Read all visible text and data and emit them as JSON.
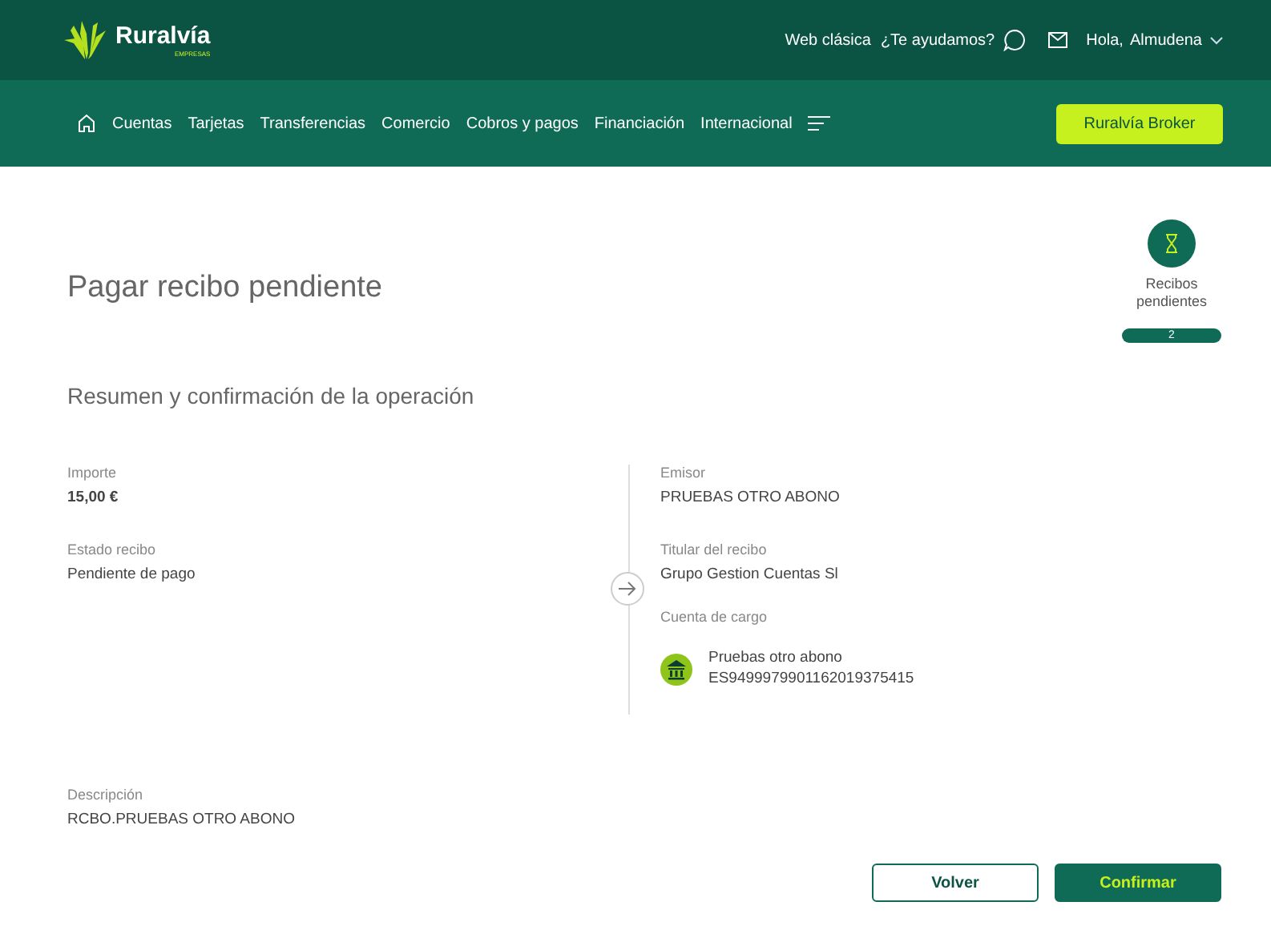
{
  "header": {
    "brand": "Ruralvía",
    "brand_sub": "EMPRESAS",
    "links": [
      "Web clásica",
      "¿Te ayudamos?"
    ],
    "greeting": "Hola,",
    "user": "Almudena"
  },
  "nav": {
    "items": [
      "Cuentas",
      "Tarjetas",
      "Transferencias",
      "Comercio",
      "Cobros y pagos",
      "Financiación",
      "Internacional"
    ],
    "action": "Ruralvía Broker"
  },
  "page": {
    "title": "Pagar recibo pendiente",
    "subtitle": "Resumen y confirmación de la operación"
  },
  "pending": {
    "label": "Recibos pendientes",
    "count": "2"
  },
  "left_fields": [
    {
      "label": "Importe",
      "value": "15,00 €",
      "bold": true
    },
    {
      "label": "Estado recibo",
      "value": "Pendiente de pago",
      "bold": false
    }
  ],
  "right_fields": [
    {
      "label": "Emisor",
      "value": "PRUEBAS OTRO ABONO"
    },
    {
      "label": "Titular del recibo",
      "value": "Grupo Gestion Cuentas Sl"
    }
  ],
  "account": {
    "label": "Cuenta de cargo",
    "name": "Pruebas otro abono",
    "iban": "ES9499979901162019375415"
  },
  "description": {
    "label": "Descripción",
    "value": "RCBO.PRUEBAS OTRO ABONO"
  },
  "buttons": [
    {
      "label": "Volver",
      "kind": "secondary"
    },
    {
      "label": "Confirmar",
      "kind": "primary"
    }
  ]
}
